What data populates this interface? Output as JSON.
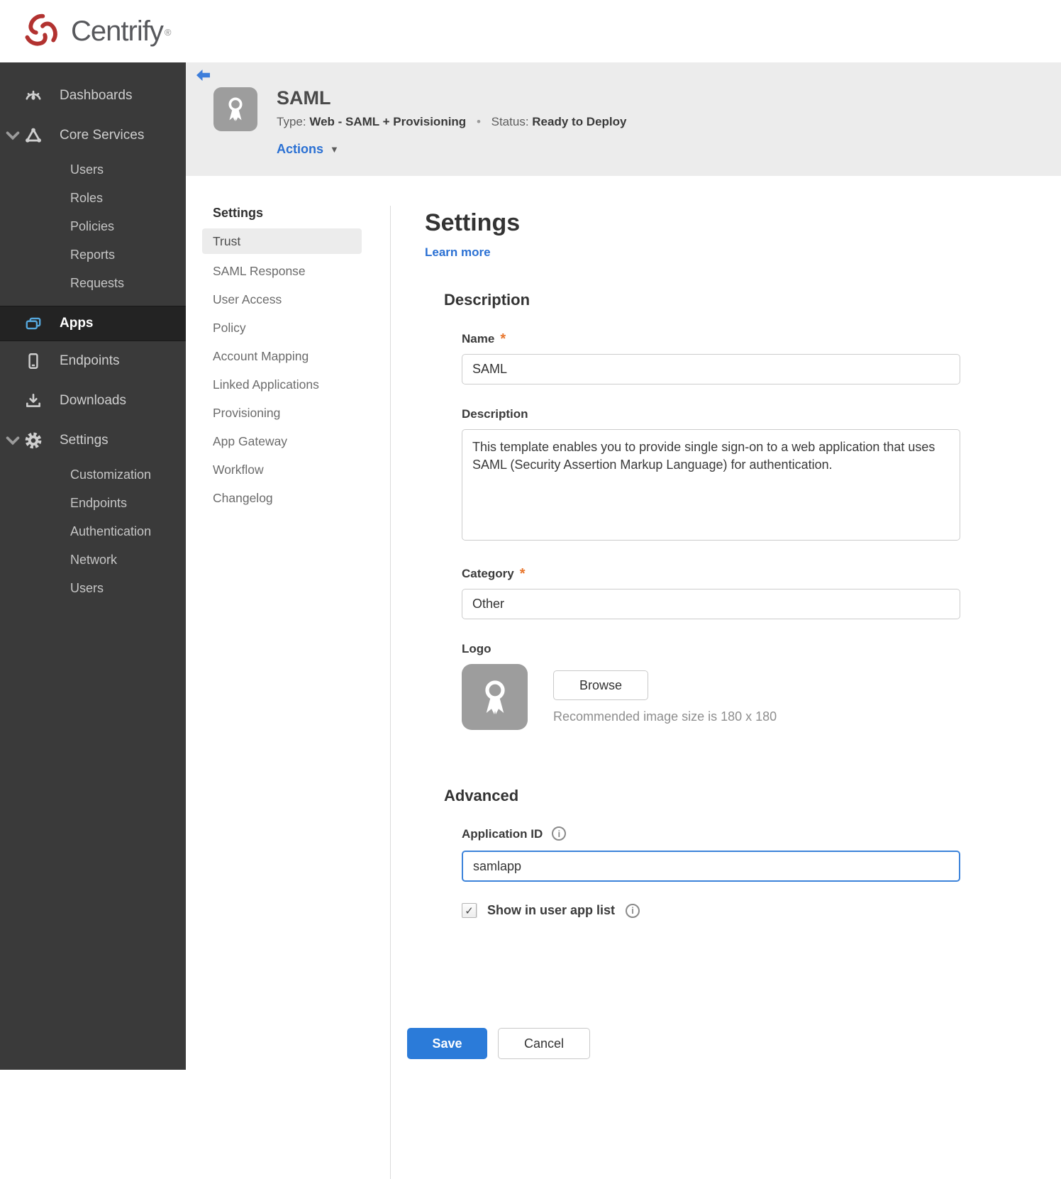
{
  "brand": {
    "name": "Centrify",
    "registered": "®"
  },
  "sidebar": {
    "dashboards": {
      "label": "Dashboards"
    },
    "core_services": {
      "label": "Core Services",
      "children": [
        "Users",
        "Roles",
        "Policies",
        "Reports",
        "Requests"
      ]
    },
    "apps": {
      "label": "Apps"
    },
    "endpoints": {
      "label": "Endpoints"
    },
    "downloads": {
      "label": "Downloads"
    },
    "settings": {
      "label": "Settings",
      "children": [
        "Customization",
        "Endpoints",
        "Authentication",
        "Network",
        "Users"
      ]
    }
  },
  "app_header": {
    "title": "SAML",
    "type_label": "Type:",
    "type_value": "Web - SAML + Provisioning",
    "separator": "•",
    "status_label": "Status:",
    "status_value": "Ready to Deploy",
    "actions_label": "Actions",
    "actions_caret": "▼"
  },
  "subnav": {
    "heading": "Settings",
    "active_item": "Trust",
    "items": [
      "Trust",
      "SAML Response",
      "User Access",
      "Policy",
      "Account Mapping",
      "Linked Applications",
      "Provisioning",
      "App Gateway",
      "Workflow",
      "Changelog"
    ]
  },
  "main": {
    "title": "Settings",
    "learn_more": "Learn more",
    "required_marker": "*",
    "description_section": {
      "heading": "Description",
      "name_label": "Name",
      "name_value": "SAML",
      "description_label": "Description",
      "description_value": "This template enables you to provide single sign-on to a web application that uses SAML (Security Assertion Markup Language) for authentication.",
      "category_label": "Category",
      "category_value": "Other",
      "logo_label": "Logo",
      "browse_button": "Browse",
      "logo_hint": "Recommended image size is 180 x 180"
    },
    "advanced_section": {
      "heading": "Advanced",
      "application_id_label": "Application ID",
      "application_id_value": "samlapp",
      "show_in_app_list_label": "Show in user app list",
      "checkbox_checked": true
    },
    "save_button": "Save",
    "cancel_button": "Cancel"
  },
  "icons": {
    "info": "i",
    "checkmark": "✓"
  },
  "colors": {
    "accent_blue": "#2b7bd9",
    "link_blue": "#2a70d3",
    "status_red": "#a21c1c",
    "sidebar_bg": "#3a3a3a",
    "header_band": "#ececec",
    "apps_icon_blue": "#55a7dc",
    "asterisk_orange": "#e8762d"
  }
}
